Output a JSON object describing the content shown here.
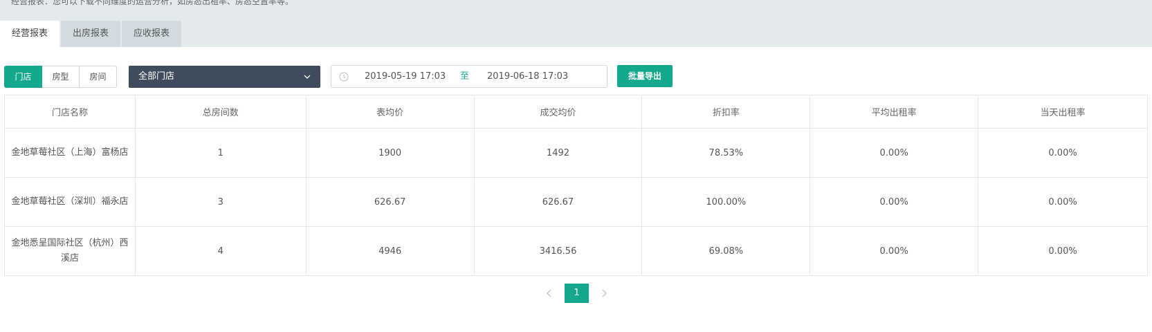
{
  "notice": "经营报表：您可以下载不同维度的运营分析，如房态出租率、房态空置率等。",
  "tabs": [
    {
      "label": "经营报表",
      "active": true
    },
    {
      "label": "出房报表",
      "active": false
    },
    {
      "label": "应收报表",
      "active": false
    }
  ],
  "dimension_buttons": [
    {
      "label": "门店",
      "active": true
    },
    {
      "label": "房型",
      "active": false
    },
    {
      "label": "房间",
      "active": false
    }
  ],
  "store_select": {
    "value": "全部门店"
  },
  "date_range": {
    "start": "2019-05-19 17:03",
    "separator": "至",
    "end": "2019-06-18 17:03"
  },
  "export_button": "批量导出",
  "table": {
    "headers": [
      "门店名称",
      "总房间数",
      "表均价",
      "成交均价",
      "折扣率",
      "平均出租率",
      "当天出租率"
    ],
    "rows": [
      [
        "金地草莓社区（上海）富杨店",
        "1",
        "1900",
        "1492",
        "78.53%",
        "0.00%",
        "0.00%"
      ],
      [
        "金地草莓社区（深圳）福永店",
        "3",
        "626.67",
        "626.67",
        "100.00%",
        "0.00%",
        "0.00%"
      ],
      [
        "金地悉呈国际社区（杭州）西溪店",
        "4",
        "4946",
        "3416.56",
        "69.08%",
        "0.00%",
        "0.00%"
      ]
    ]
  },
  "pagination": {
    "current": "1"
  },
  "colors": {
    "accent": "#14a88c",
    "select_bg": "#3e4c5e",
    "top_bg": "#e4e9eb"
  }
}
